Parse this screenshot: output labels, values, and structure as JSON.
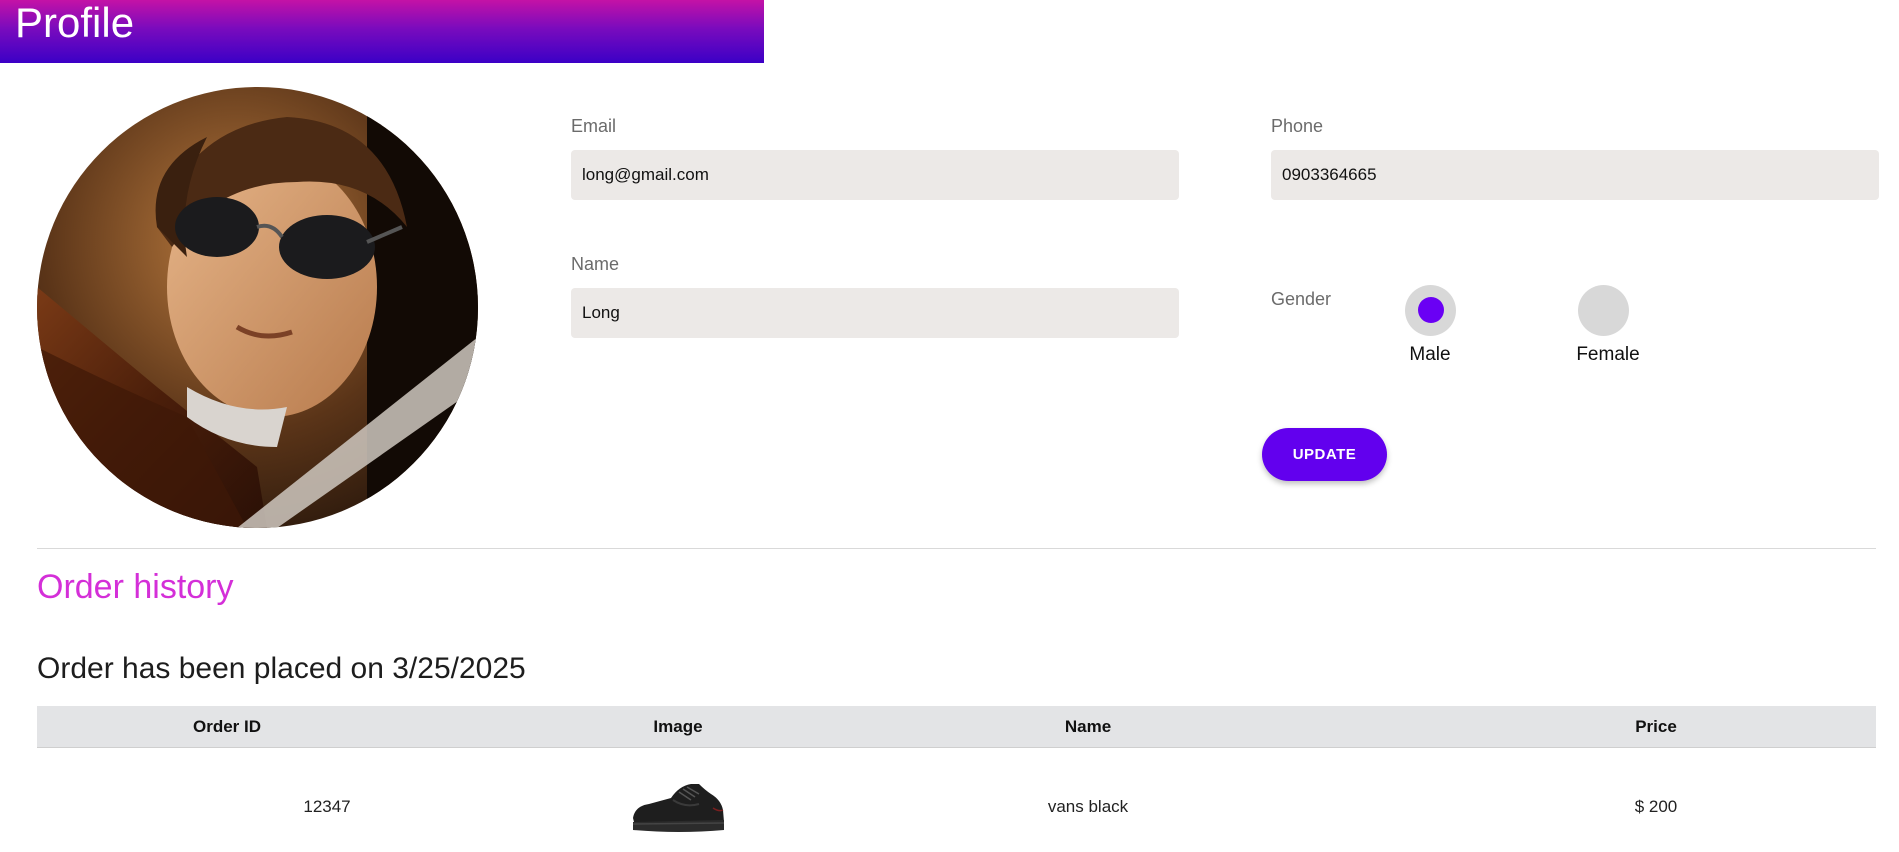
{
  "header": {
    "title": "Profile"
  },
  "profile": {
    "email_label": "Email",
    "email_value": "long@gmail.com",
    "phone_label": "Phone",
    "phone_value": "0903364665",
    "name_label": "Name",
    "name_value": "Long",
    "gender_label": "Gender",
    "gender_options": [
      "Male",
      "Female"
    ],
    "gender_selected": "Male",
    "update_label": "UPDATE"
  },
  "orders": {
    "section_title": "Order history",
    "order_heading": "Order has been placed on 3/25/2025",
    "columns": [
      "Order ID",
      "Image",
      "Name",
      "Price"
    ],
    "rows": [
      {
        "order_id": "12347",
        "image_icon": "black-sneaker-image",
        "name": "vans black",
        "price": "$ 200"
      }
    ]
  },
  "colors": {
    "accent": "#6200ee",
    "radio_selected": "#6a00f4",
    "history_title": "#d42fd8",
    "banner_top": "#c412a6",
    "banner_bottom": "#3b00c6"
  }
}
